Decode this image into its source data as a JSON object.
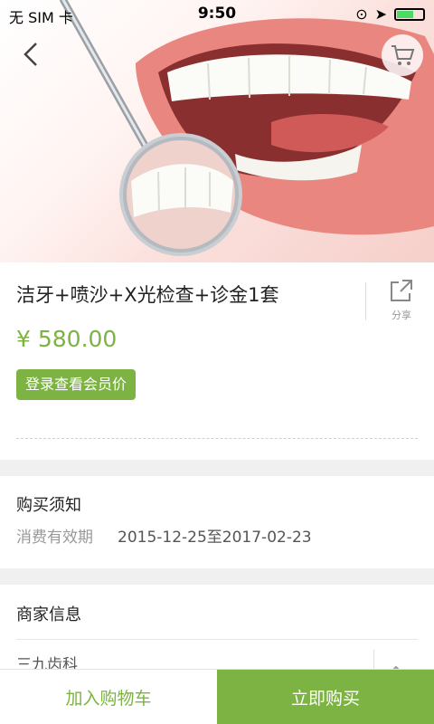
{
  "status_bar": {
    "carrier": "无 SIM 卡",
    "time": "9:50"
  },
  "header": {
    "back_icon": "chevron-left-icon",
    "cart_icon": "cart-icon"
  },
  "product": {
    "image_subject": "teeth-and-dental-mirror",
    "title": "洁牙+喷沙+X光检查+诊金1套",
    "share_label": "分享",
    "price": "¥ 580.00",
    "member_button": "登录查看会员价"
  },
  "purchase_notice": {
    "title": "购买须知",
    "validity_label": "消费有效期",
    "validity_value": "2015-12-25至2017-02-23"
  },
  "merchant": {
    "title": "商家信息",
    "name": "三九齿科"
  },
  "bottom_bar": {
    "add_to_cart": "加入购物车",
    "buy_now": "立即购买"
  },
  "colors": {
    "accent": "#7cb342"
  }
}
